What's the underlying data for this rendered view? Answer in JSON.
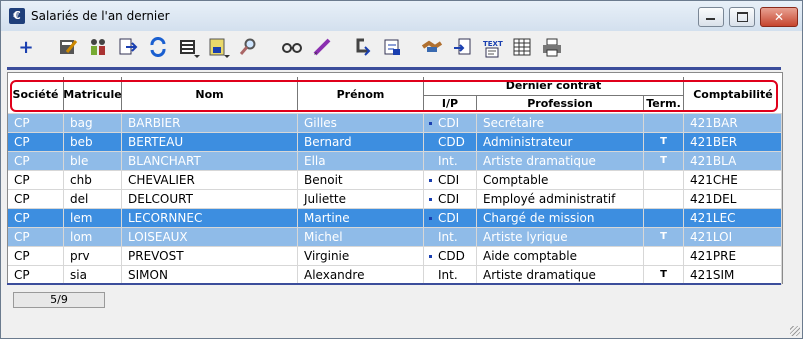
{
  "window": {
    "title": "Salariés de l'an dernier",
    "icon_letter": "€",
    "close_label": "✕"
  },
  "toolbar": [
    "add-icon",
    "pencil-form-icon",
    "people-icon",
    "export-icon",
    "refresh-icon",
    "list-select-icon",
    "save-doc-icon",
    "search-icon",
    "glasses-icon",
    "pencil-icon",
    "reply-icon",
    "print-preview-icon",
    "handshake-icon",
    "document-arrow-icon",
    "text-icon",
    "table-icon",
    "printer-icon"
  ],
  "columns": {
    "societe": "Société",
    "matricule": "Matricule",
    "nom": "Nom",
    "prenom": "Prénom",
    "dernier_contrat": "Dernier contrat",
    "ip": "I/P",
    "profession": "Profession",
    "term": "Term.",
    "comptabilite": "Comptabilité"
  },
  "rows": [
    {
      "style": "light",
      "societe": "CP",
      "matricule": "bag",
      "nom": "BARBIER",
      "prenom": "Gilles",
      "dot": true,
      "ip": "CDI",
      "profession": "Secrétaire",
      "term": "",
      "compta": "421BAR"
    },
    {
      "style": "dark",
      "societe": "CP",
      "matricule": "beb",
      "nom": "BERTEAU",
      "prenom": "Bernard",
      "dot": false,
      "ip": "CDD",
      "profession": "Administrateur",
      "term": "T",
      "compta": "421BER"
    },
    {
      "style": "light",
      "societe": "CP",
      "matricule": "ble",
      "nom": "BLANCHART",
      "prenom": "Ella",
      "dot": false,
      "ip": "Int.",
      "profession": "Artiste dramatique",
      "term": "T",
      "compta": "421BLA"
    },
    {
      "style": "white",
      "societe": "CP",
      "matricule": "chb",
      "nom": "CHEVALIER",
      "prenom": "Benoit",
      "dot": true,
      "ip": "CDI",
      "profession": "Comptable",
      "term": "",
      "compta": "421CHE"
    },
    {
      "style": "white",
      "societe": "CP",
      "matricule": "del",
      "nom": "DELCOURT",
      "prenom": "Juliette",
      "dot": true,
      "ip": "CDI",
      "profession": "Employé administratif",
      "term": "",
      "compta": "421DEL"
    },
    {
      "style": "dark",
      "societe": "CP",
      "matricule": "lem",
      "nom": "LECORNNEC",
      "prenom": "Martine",
      "dot": true,
      "ip": "CDI",
      "profession": "Chargé de mission",
      "term": "",
      "compta": "421LEC"
    },
    {
      "style": "light",
      "societe": "CP",
      "matricule": "lom",
      "nom": "LOISEAUX",
      "prenom": "Michel",
      "dot": false,
      "ip": "Int.",
      "profession": "Artiste lyrique",
      "term": "T",
      "compta": "421LOI"
    },
    {
      "style": "white",
      "societe": "CP",
      "matricule": "prv",
      "nom": "PREVOST",
      "prenom": "Virginie",
      "dot": true,
      "ip": "CDD",
      "profession": "Aide comptable",
      "term": "",
      "compta": "421PRE"
    },
    {
      "style": "white",
      "societe": "CP",
      "matricule": "sia",
      "nom": "SIMON",
      "prenom": "Alexandre",
      "dot": false,
      "ip": "Int.",
      "profession": "Artiste dramatique",
      "term": "T",
      "compta": "421SIM"
    }
  ],
  "status": {
    "record_counter": "5/9"
  }
}
